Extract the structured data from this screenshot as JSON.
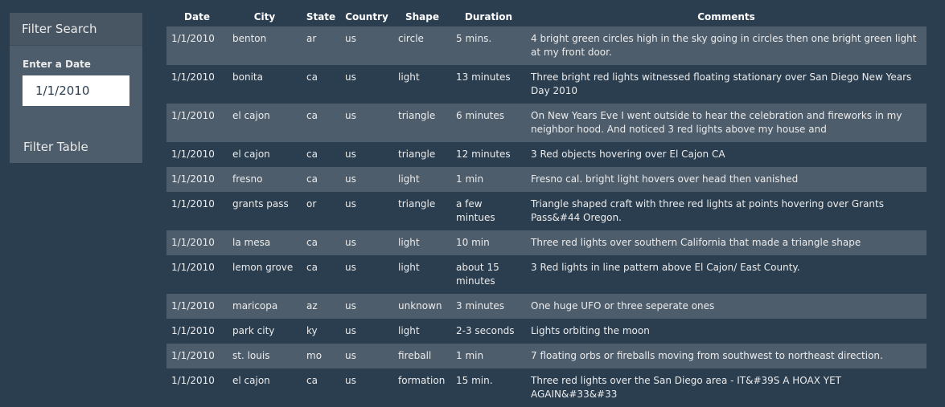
{
  "sidebar": {
    "title": "Filter Search",
    "date_label": "Enter a Date",
    "date_value": "1/1/2010",
    "filter_button": "Filter Table"
  },
  "table": {
    "headers": [
      "Date",
      "City",
      "State",
      "Country",
      "Shape",
      "Duration",
      "Comments"
    ],
    "rows": [
      {
        "date": "1/1/2010",
        "city": "benton",
        "state": "ar",
        "country": "us",
        "shape": "circle",
        "duration": "5 mins.",
        "comments": "4 bright green circles high in the sky going in circles then one bright green light at my front door."
      },
      {
        "date": "1/1/2010",
        "city": "bonita",
        "state": "ca",
        "country": "us",
        "shape": "light",
        "duration": "13 minutes",
        "comments": "Three bright red lights witnessed floating stationary over San Diego New Years Day 2010"
      },
      {
        "date": "1/1/2010",
        "city": "el cajon",
        "state": "ca",
        "country": "us",
        "shape": "triangle",
        "duration": "6 minutes",
        "comments": "On New Years Eve I went outside to hear the celebration and fireworks in my neighbor hood. And noticed 3 red lights above my house and"
      },
      {
        "date": "1/1/2010",
        "city": "el cajon",
        "state": "ca",
        "country": "us",
        "shape": "triangle",
        "duration": "12 minutes",
        "comments": "3 Red objects hovering over El Cajon CA"
      },
      {
        "date": "1/1/2010",
        "city": "fresno",
        "state": "ca",
        "country": "us",
        "shape": "light",
        "duration": "1 min",
        "comments": "Fresno cal. bright light hovers over head then vanished"
      },
      {
        "date": "1/1/2010",
        "city": "grants pass",
        "state": "or",
        "country": "us",
        "shape": "triangle",
        "duration": "a few mintues",
        "comments": "Triangle shaped craft with three red lights at points hovering over Grants Pass&#44 Oregon."
      },
      {
        "date": "1/1/2010",
        "city": "la mesa",
        "state": "ca",
        "country": "us",
        "shape": "light",
        "duration": "10 min",
        "comments": "Three red lights over southern California that made a triangle shape"
      },
      {
        "date": "1/1/2010",
        "city": "lemon grove",
        "state": "ca",
        "country": "us",
        "shape": "light",
        "duration": "about 15 minutes",
        "comments": "3 Red lights in line pattern above El Cajon/ East County."
      },
      {
        "date": "1/1/2010",
        "city": "maricopa",
        "state": "az",
        "country": "us",
        "shape": "unknown",
        "duration": "3 minutes",
        "comments": "One huge UFO or three seperate ones"
      },
      {
        "date": "1/1/2010",
        "city": "park city",
        "state": "ky",
        "country": "us",
        "shape": "light",
        "duration": "2-3 seconds",
        "comments": "Lights orbiting the moon"
      },
      {
        "date": "1/1/2010",
        "city": "st. louis",
        "state": "mo",
        "country": "us",
        "shape": "fireball",
        "duration": "1 min",
        "comments": "7 floating orbs or fireballs moving from southwest to northeast direction."
      },
      {
        "date": "1/1/2010",
        "city": "el cajon",
        "state": "ca",
        "country": "us",
        "shape": "formation",
        "duration": "15 min.",
        "comments": "Three red lights over the San Diego area - IT&#39S A HOAX YET AGAIN&#33&#33"
      }
    ]
  }
}
